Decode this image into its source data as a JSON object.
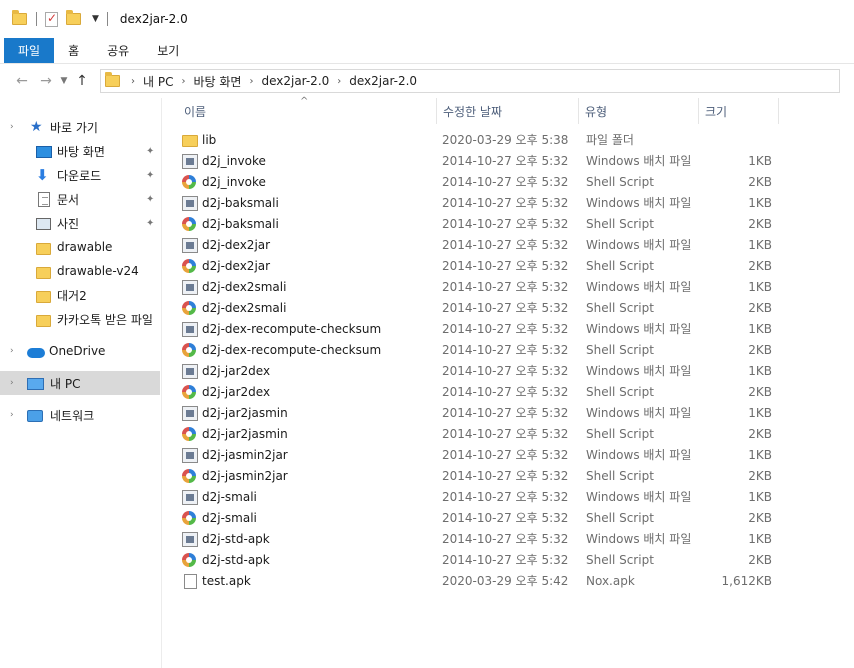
{
  "window": {
    "title": "dex2jar-2.0"
  },
  "ribbon": {
    "tabs": [
      "파일",
      "홈",
      "공유",
      "보기"
    ]
  },
  "address": {
    "crumbs": [
      "내 PC",
      "바탕 화면",
      "dex2jar-2.0",
      "dex2jar-2.0"
    ]
  },
  "nav": {
    "items": [
      {
        "label": "바로 가기",
        "icon": "star-icon"
      },
      {
        "label": "바탕 화면",
        "icon": "desktop-icon",
        "pinned": true
      },
      {
        "label": "다운로드",
        "icon": "download-icon",
        "pinned": true
      },
      {
        "label": "문서",
        "icon": "document-icon",
        "pinned": true
      },
      {
        "label": "사진",
        "icon": "pictures-icon",
        "pinned": true
      },
      {
        "label": "drawable",
        "icon": "folder-icon"
      },
      {
        "label": "drawable-v24",
        "icon": "folder-icon"
      },
      {
        "label": "대거2",
        "icon": "folder-icon"
      },
      {
        "label": "카카오톡 받은 파일",
        "icon": "folder-icon"
      },
      {
        "label": "OneDrive",
        "icon": "onedrive-icon"
      },
      {
        "label": "내 PC",
        "icon": "pc-icon"
      },
      {
        "label": "네트워크",
        "icon": "network-icon"
      }
    ]
  },
  "columns": {
    "name": "이름",
    "date": "수정한 날짜",
    "type": "유형",
    "size": "크기"
  },
  "files": [
    {
      "name": "lib",
      "date": "2020-03-29 오후 5:38",
      "type": "파일 폴더",
      "size": "",
      "icon": "folder"
    },
    {
      "name": "d2j_invoke",
      "date": "2014-10-27 오후 5:32",
      "type": "Windows 배치 파일",
      "size": "1KB",
      "icon": "bat"
    },
    {
      "name": "d2j_invoke",
      "date": "2014-10-27 오후 5:32",
      "type": "Shell Script",
      "size": "2KB",
      "icon": "sh"
    },
    {
      "name": "d2j-baksmali",
      "date": "2014-10-27 오후 5:32",
      "type": "Windows 배치 파일",
      "size": "1KB",
      "icon": "bat"
    },
    {
      "name": "d2j-baksmali",
      "date": "2014-10-27 오후 5:32",
      "type": "Shell Script",
      "size": "2KB",
      "icon": "sh"
    },
    {
      "name": "d2j-dex2jar",
      "date": "2014-10-27 오후 5:32",
      "type": "Windows 배치 파일",
      "size": "1KB",
      "icon": "bat"
    },
    {
      "name": "d2j-dex2jar",
      "date": "2014-10-27 오후 5:32",
      "type": "Shell Script",
      "size": "2KB",
      "icon": "sh"
    },
    {
      "name": "d2j-dex2smali",
      "date": "2014-10-27 오후 5:32",
      "type": "Windows 배치 파일",
      "size": "1KB",
      "icon": "bat"
    },
    {
      "name": "d2j-dex2smali",
      "date": "2014-10-27 오후 5:32",
      "type": "Shell Script",
      "size": "2KB",
      "icon": "sh"
    },
    {
      "name": "d2j-dex-recompute-checksum",
      "date": "2014-10-27 오후 5:32",
      "type": "Windows 배치 파일",
      "size": "1KB",
      "icon": "bat"
    },
    {
      "name": "d2j-dex-recompute-checksum",
      "date": "2014-10-27 오후 5:32",
      "type": "Shell Script",
      "size": "2KB",
      "icon": "sh"
    },
    {
      "name": "d2j-jar2dex",
      "date": "2014-10-27 오후 5:32",
      "type": "Windows 배치 파일",
      "size": "1KB",
      "icon": "bat"
    },
    {
      "name": "d2j-jar2dex",
      "date": "2014-10-27 오후 5:32",
      "type": "Shell Script",
      "size": "2KB",
      "icon": "sh"
    },
    {
      "name": "d2j-jar2jasmin",
      "date": "2014-10-27 오후 5:32",
      "type": "Windows 배치 파일",
      "size": "1KB",
      "icon": "bat"
    },
    {
      "name": "d2j-jar2jasmin",
      "date": "2014-10-27 오후 5:32",
      "type": "Shell Script",
      "size": "2KB",
      "icon": "sh"
    },
    {
      "name": "d2j-jasmin2jar",
      "date": "2014-10-27 오후 5:32",
      "type": "Windows 배치 파일",
      "size": "1KB",
      "icon": "bat"
    },
    {
      "name": "d2j-jasmin2jar",
      "date": "2014-10-27 오후 5:32",
      "type": "Shell Script",
      "size": "2KB",
      "icon": "sh"
    },
    {
      "name": "d2j-smali",
      "date": "2014-10-27 오후 5:32",
      "type": "Windows 배치 파일",
      "size": "1KB",
      "icon": "bat"
    },
    {
      "name": "d2j-smali",
      "date": "2014-10-27 오후 5:32",
      "type": "Shell Script",
      "size": "2KB",
      "icon": "sh"
    },
    {
      "name": "d2j-std-apk",
      "date": "2014-10-27 오후 5:32",
      "type": "Windows 배치 파일",
      "size": "1KB",
      "icon": "bat"
    },
    {
      "name": "d2j-std-apk",
      "date": "2014-10-27 오후 5:32",
      "type": "Shell Script",
      "size": "2KB",
      "icon": "sh"
    },
    {
      "name": "test.apk",
      "date": "2020-03-29 오후 5:42",
      "type": "Nox.apk",
      "size": "1,612KB",
      "icon": "apk"
    }
  ]
}
